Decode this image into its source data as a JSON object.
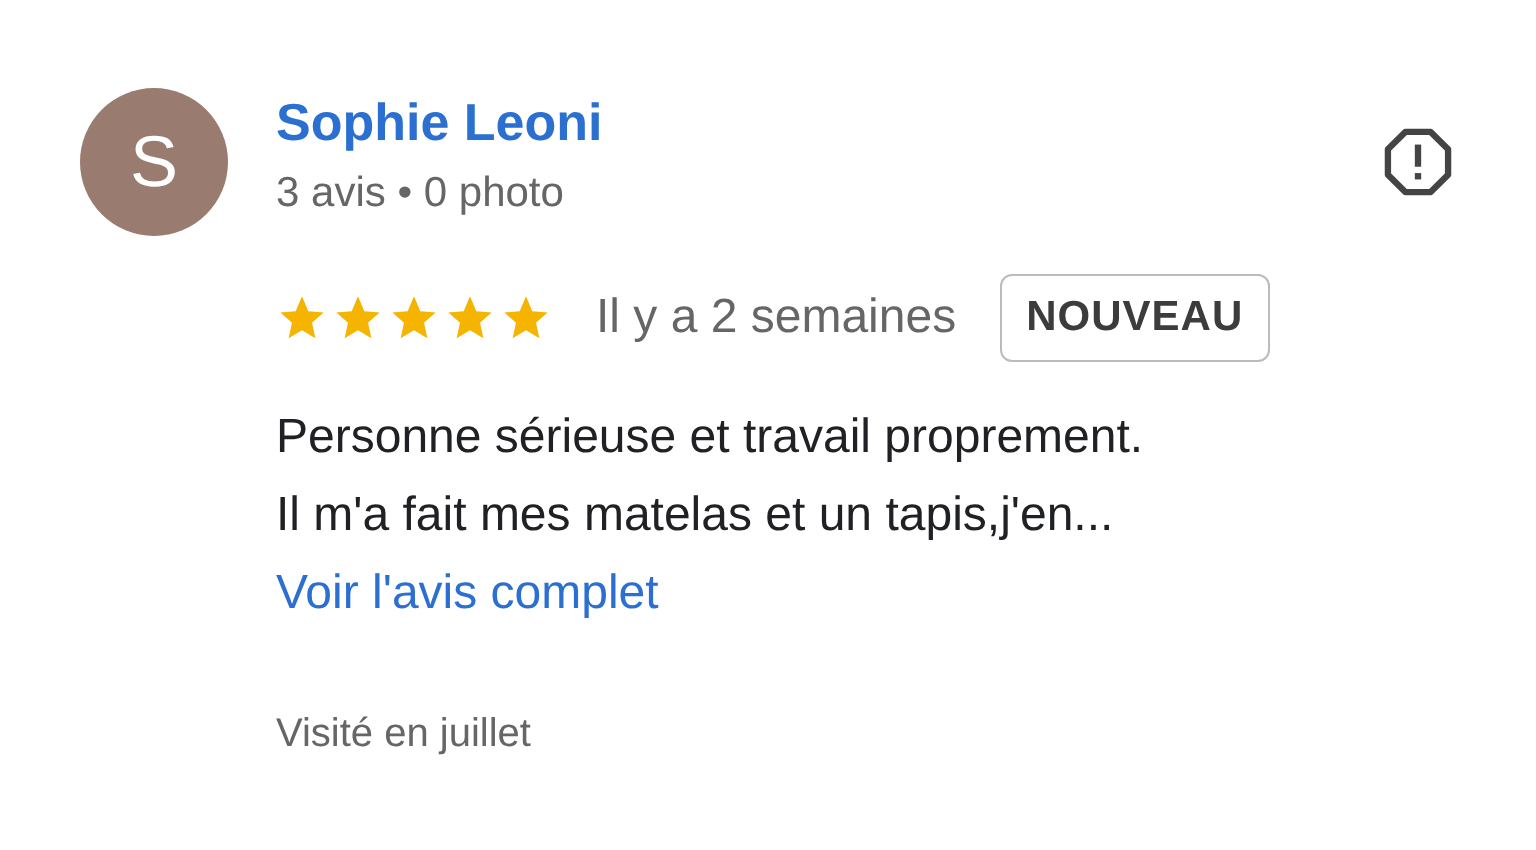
{
  "review": {
    "avatar_letter": "S",
    "author": "Sophie Leoni",
    "meta": "3 avis • 0 photo",
    "stars": 5,
    "time": "Il y a 2 semaines",
    "badge": "NOUVEAU",
    "text": "Personne sérieuse et travail proprement.\nIl m'a fait mes matelas et un tapis,j'en...",
    "more_link": "Voir l'avis complet",
    "visited": "Visité en juillet"
  }
}
